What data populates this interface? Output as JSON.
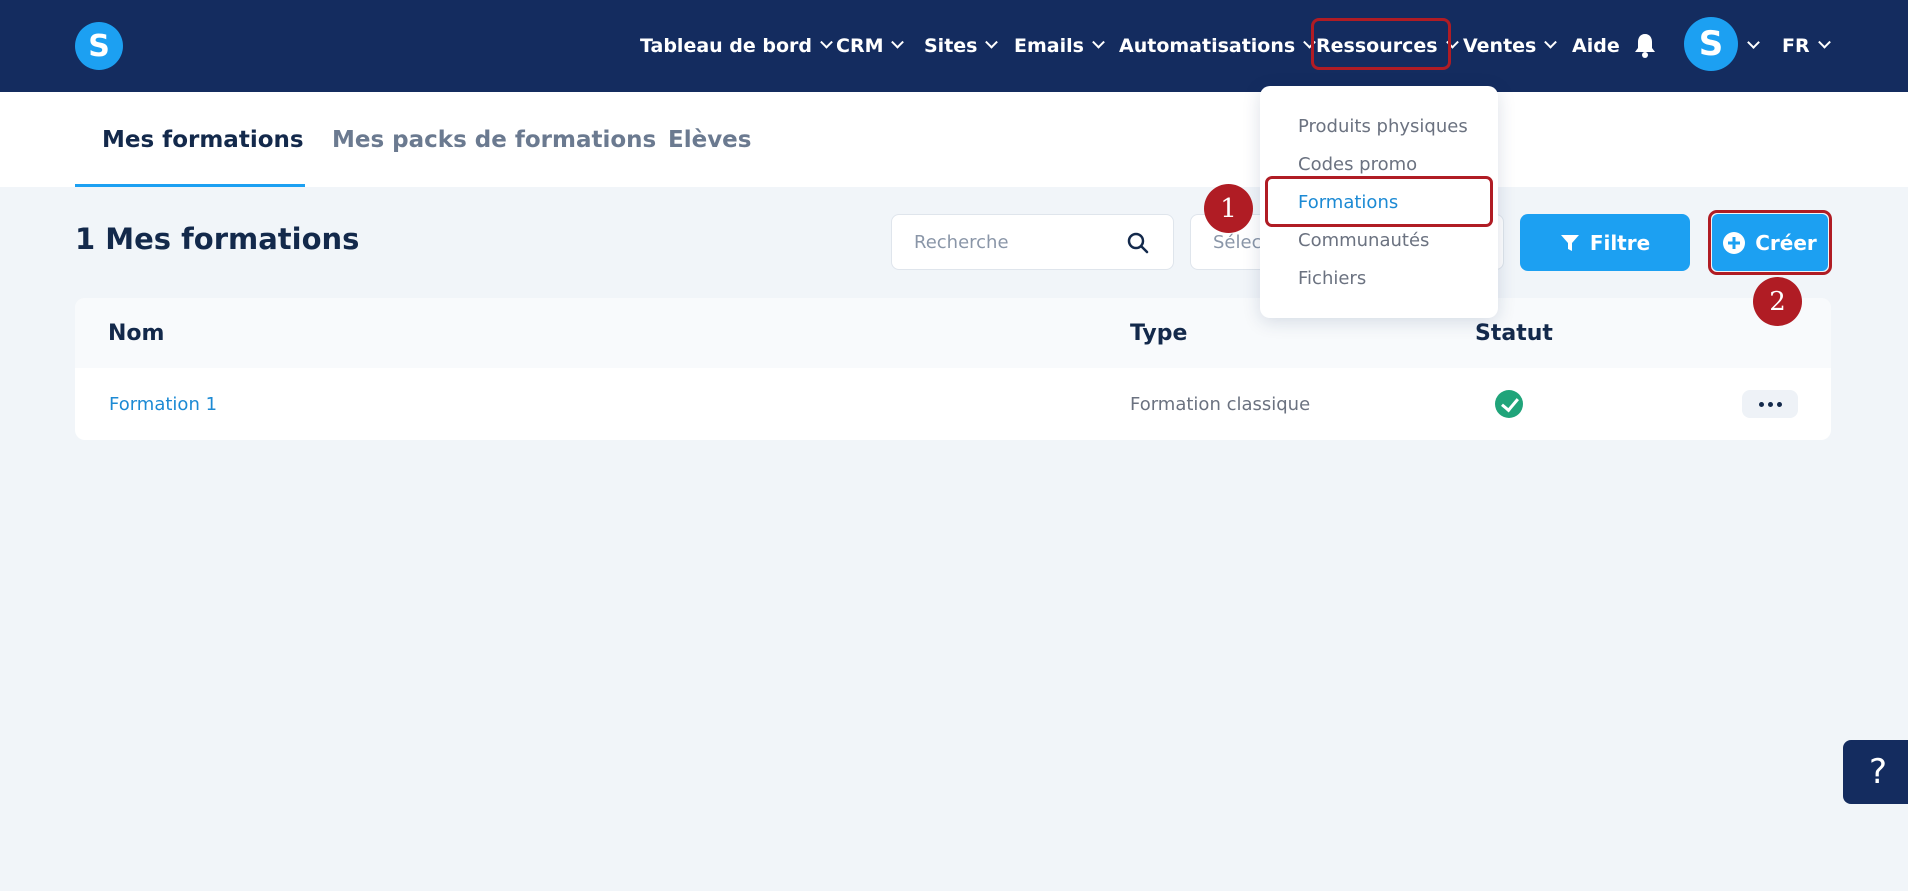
{
  "app": {
    "logo_letter": "S",
    "avatar_letter": "S",
    "colors": {
      "nav_bg": "#142c5f",
      "accent": "#1ca0f2",
      "highlight": "#b01c24",
      "success": "#20a47a"
    }
  },
  "nav": {
    "items": [
      {
        "label": "Tableau de bord"
      },
      {
        "label": "CRM"
      },
      {
        "label": "Sites"
      },
      {
        "label": "Emails"
      },
      {
        "label": "Automatisations"
      },
      {
        "label": "Ressources"
      },
      {
        "label": "Ventes"
      },
      {
        "label": "Aide"
      }
    ],
    "language": "FR",
    "bell_icon": "bell-icon"
  },
  "tabs": [
    {
      "label": "Mes formations",
      "active": true
    },
    {
      "label": "Mes packs de formations",
      "active": false
    },
    {
      "label": "Elèves",
      "active": false
    }
  ],
  "main": {
    "title": "1 Mes formations",
    "search": {
      "placeholder": "Recherche",
      "value": ""
    },
    "select": {
      "placeholder": "Sélec"
    },
    "filter_label": "Filtre",
    "create_label": "Créer"
  },
  "table": {
    "columns": [
      "Nom",
      "Type",
      "Statut"
    ],
    "rows": [
      {
        "name": "Formation 1",
        "type": "Formation classique",
        "status": "active"
      }
    ]
  },
  "dropdown": {
    "items": [
      {
        "label": "Produits physiques"
      },
      {
        "label": "Codes promo"
      },
      {
        "label": "Formations",
        "active": true
      },
      {
        "label": "Communautés"
      },
      {
        "label": "Fichiers"
      }
    ]
  },
  "steps": [
    "1",
    "2"
  ],
  "help_label": "?"
}
